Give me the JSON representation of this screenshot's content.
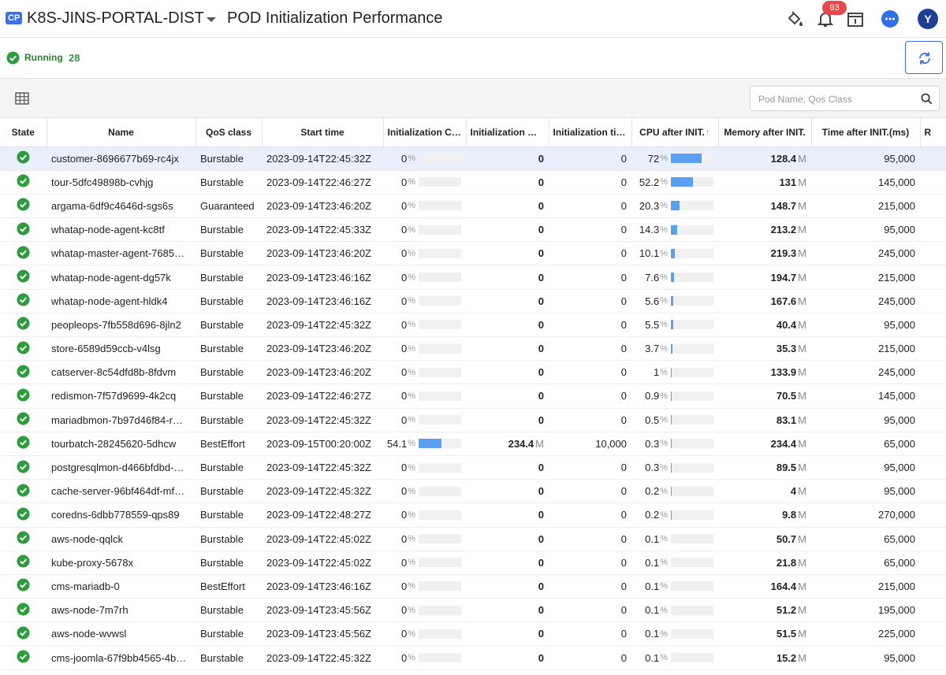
{
  "header": {
    "badge": "CP",
    "project": "K8S-JINS-PORTAL-DIST",
    "title": "POD Initialization Performance",
    "notification_count": "93",
    "avatar_letter": "Y"
  },
  "status": {
    "label": "Running",
    "count": "28"
  },
  "search": {
    "placeholder": "Pod Name, Qos Class"
  },
  "columns": [
    "State",
    "Name",
    "QoS class",
    "Start time",
    "Initialization CPU",
    "Initialization memory",
    "Initialization time",
    "CPU after INIT.",
    "Memory after INIT.",
    "Time after INIT.(ms)",
    "R"
  ],
  "sort_indicator": "↑",
  "units": {
    "pct": "%",
    "mem": "M"
  },
  "rows": [
    {
      "name": "customer-8696677b69-rc4jx",
      "qos": "Burstable",
      "start": "2023-09-14T22:45:32Z",
      "init_cpu": "0",
      "init_cpu_pct": 0,
      "init_mem": "0",
      "init_time": "0",
      "cpu_after": "72",
      "cpu_after_pct": 72,
      "mem_after": "128.4",
      "time_after": "95,000"
    },
    {
      "name": "tour-5dfc49898b-cvhjg",
      "qos": "Burstable",
      "start": "2023-09-14T22:46:27Z",
      "init_cpu": "0",
      "init_cpu_pct": 0,
      "init_mem": "0",
      "init_time": "0",
      "cpu_after": "52.2",
      "cpu_after_pct": 52.2,
      "mem_after": "131",
      "time_after": "145,000"
    },
    {
      "name": "argama-6df9c4646d-sgs6s",
      "qos": "Guaranteed",
      "start": "2023-09-14T23:46:20Z",
      "init_cpu": "0",
      "init_cpu_pct": 0,
      "init_mem": "0",
      "init_time": "0",
      "cpu_after": "20.3",
      "cpu_after_pct": 20.3,
      "mem_after": "148.7",
      "time_after": "215,000"
    },
    {
      "name": "whatap-node-agent-kc8tf",
      "qos": "Burstable",
      "start": "2023-09-14T22:45:33Z",
      "init_cpu": "0",
      "init_cpu_pct": 0,
      "init_mem": "0",
      "init_time": "0",
      "cpu_after": "14.3",
      "cpu_after_pct": 14.3,
      "mem_after": "213.2",
      "time_after": "95,000"
    },
    {
      "name": "whatap-master-agent-7685…",
      "qos": "Burstable",
      "start": "2023-09-14T23:46:20Z",
      "init_cpu": "0",
      "init_cpu_pct": 0,
      "init_mem": "0",
      "init_time": "0",
      "cpu_after": "10.1",
      "cpu_after_pct": 10.1,
      "mem_after": "219.3",
      "time_after": "245,000"
    },
    {
      "name": "whatap-node-agent-dg57k",
      "qos": "Burstable",
      "start": "2023-09-14T23:46:16Z",
      "init_cpu": "0",
      "init_cpu_pct": 0,
      "init_mem": "0",
      "init_time": "0",
      "cpu_after": "7.6",
      "cpu_after_pct": 7.6,
      "mem_after": "194.7",
      "time_after": "215,000"
    },
    {
      "name": "whatap-node-agent-hldk4",
      "qos": "Burstable",
      "start": "2023-09-14T23:46:16Z",
      "init_cpu": "0",
      "init_cpu_pct": 0,
      "init_mem": "0",
      "init_time": "0",
      "cpu_after": "5.6",
      "cpu_after_pct": 5.6,
      "mem_after": "167.6",
      "time_after": "245,000"
    },
    {
      "name": "peopleops-7fb558d696-8jln2",
      "qos": "Burstable",
      "start": "2023-09-14T22:45:32Z",
      "init_cpu": "0",
      "init_cpu_pct": 0,
      "init_mem": "0",
      "init_time": "0",
      "cpu_after": "5.5",
      "cpu_after_pct": 5.5,
      "mem_after": "40.4",
      "time_after": "95,000"
    },
    {
      "name": "store-6589d59ccb-v4lsg",
      "qos": "Burstable",
      "start": "2023-09-14T23:46:20Z",
      "init_cpu": "0",
      "init_cpu_pct": 0,
      "init_mem": "0",
      "init_time": "0",
      "cpu_after": "3.7",
      "cpu_after_pct": 3.7,
      "mem_after": "35.3",
      "time_after": "215,000"
    },
    {
      "name": "catserver-8c54dfd8b-8fdvm",
      "qos": "Burstable",
      "start": "2023-09-14T23:46:20Z",
      "init_cpu": "0",
      "init_cpu_pct": 0,
      "init_mem": "0",
      "init_time": "0",
      "cpu_after": "1",
      "cpu_after_pct": 1,
      "mem_after": "133.9",
      "time_after": "245,000"
    },
    {
      "name": "redismon-7f57d9699-4k2cq",
      "qos": "Burstable",
      "start": "2023-09-14T22:46:27Z",
      "init_cpu": "0",
      "init_cpu_pct": 0,
      "init_mem": "0",
      "init_time": "0",
      "cpu_after": "0.9",
      "cpu_after_pct": 0.9,
      "mem_after": "70.5",
      "time_after": "145,000"
    },
    {
      "name": "mariadbmon-7b97d46f84-r…",
      "qos": "Burstable",
      "start": "2023-09-14T22:45:32Z",
      "init_cpu": "0",
      "init_cpu_pct": 0,
      "init_mem": "0",
      "init_time": "0",
      "cpu_after": "0.5",
      "cpu_after_pct": 0.5,
      "mem_after": "83.1",
      "time_after": "95,000"
    },
    {
      "name": "tourbatch-28245620-5dhcw",
      "qos": "BestEffort",
      "start": "2023-09-15T00:20:00Z",
      "init_cpu": "54.1",
      "init_cpu_pct": 54.1,
      "init_mem": "234.4",
      "init_mem_unit": true,
      "init_time": "10,000",
      "cpu_after": "0.3",
      "cpu_after_pct": 0.3,
      "mem_after": "234.4",
      "time_after": "65,000"
    },
    {
      "name": "postgresqlmon-d466bfdbd-…",
      "qos": "Burstable",
      "start": "2023-09-14T22:45:32Z",
      "init_cpu": "0",
      "init_cpu_pct": 0,
      "init_mem": "0",
      "init_time": "0",
      "cpu_after": "0.3",
      "cpu_after_pct": 0.3,
      "mem_after": "89.5",
      "time_after": "95,000"
    },
    {
      "name": "cache-server-96bf464df-mf…",
      "qos": "Burstable",
      "start": "2023-09-14T22:45:32Z",
      "init_cpu": "0",
      "init_cpu_pct": 0,
      "init_mem": "0",
      "init_time": "0",
      "cpu_after": "0.2",
      "cpu_after_pct": 0.2,
      "mem_after": "4",
      "time_after": "95,000"
    },
    {
      "name": "coredns-6dbb778559-qps89",
      "qos": "Burstable",
      "start": "2023-09-14T22:48:27Z",
      "init_cpu": "0",
      "init_cpu_pct": 0,
      "init_mem": "0",
      "init_time": "0",
      "cpu_after": "0.2",
      "cpu_after_pct": 0.2,
      "mem_after": "9.8",
      "time_after": "270,000"
    },
    {
      "name": "aws-node-qqlck",
      "qos": "Burstable",
      "start": "2023-09-14T22:45:02Z",
      "init_cpu": "0",
      "init_cpu_pct": 0,
      "init_mem": "0",
      "init_time": "0",
      "cpu_after": "0.1",
      "cpu_after_pct": 0.1,
      "mem_after": "50.7",
      "time_after": "65,000"
    },
    {
      "name": "kube-proxy-5678x",
      "qos": "Burstable",
      "start": "2023-09-14T22:45:02Z",
      "init_cpu": "0",
      "init_cpu_pct": 0,
      "init_mem": "0",
      "init_time": "0",
      "cpu_after": "0.1",
      "cpu_after_pct": 0.1,
      "mem_after": "21.8",
      "time_after": "65,000"
    },
    {
      "name": "cms-mariadb-0",
      "qos": "BestEffort",
      "start": "2023-09-14T23:46:16Z",
      "init_cpu": "0",
      "init_cpu_pct": 0,
      "init_mem": "0",
      "init_time": "0",
      "cpu_after": "0.1",
      "cpu_after_pct": 0.1,
      "mem_after": "164.4",
      "time_after": "215,000"
    },
    {
      "name": "aws-node-7m7rh",
      "qos": "Burstable",
      "start": "2023-09-14T23:45:56Z",
      "init_cpu": "0",
      "init_cpu_pct": 0,
      "init_mem": "0",
      "init_time": "0",
      "cpu_after": "0.1",
      "cpu_after_pct": 0.1,
      "mem_after": "51.2",
      "time_after": "195,000"
    },
    {
      "name": "aws-node-wvwsl",
      "qos": "Burstable",
      "start": "2023-09-14T23:45:56Z",
      "init_cpu": "0",
      "init_cpu_pct": 0,
      "init_mem": "0",
      "init_time": "0",
      "cpu_after": "0.1",
      "cpu_after_pct": 0.1,
      "mem_after": "51.5",
      "time_after": "225,000"
    },
    {
      "name": "cms-joomla-67f9bb4565-4b…",
      "qos": "Burstable",
      "start": "2023-09-14T22:45:32Z",
      "init_cpu": "0",
      "init_cpu_pct": 0,
      "init_mem": "0",
      "init_time": "0",
      "cpu_after": "0.1",
      "cpu_after_pct": 0.1,
      "mem_after": "15.2",
      "time_after": "95,000"
    }
  ],
  "selected_row": 0,
  "colors": {
    "accent": "#3b6ee8",
    "running": "#2e9b3e",
    "bar": "#5a9ff0",
    "badge": "#e5484d",
    "avatar": "#1f3f97"
  }
}
